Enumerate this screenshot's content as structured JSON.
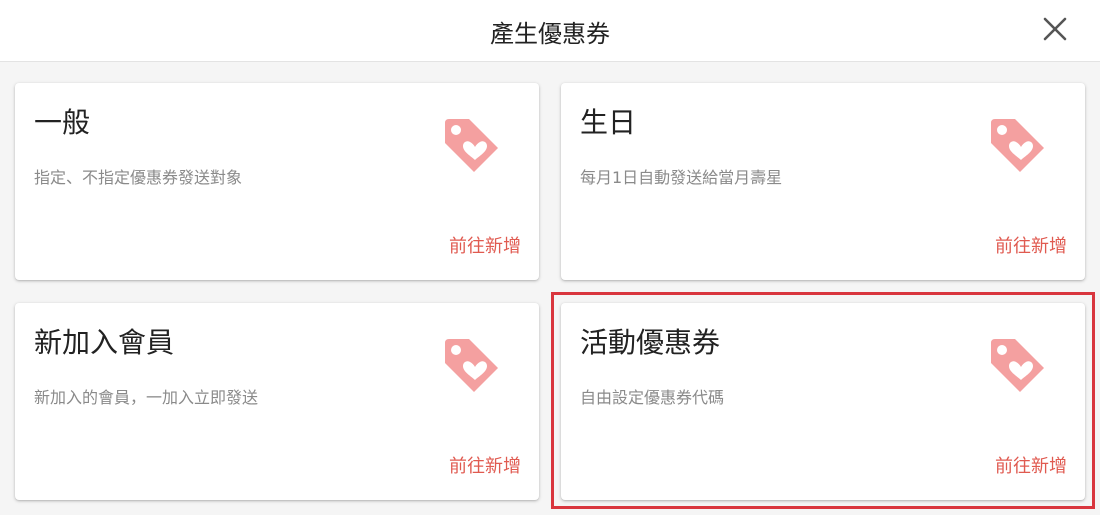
{
  "header": {
    "title": "產生優惠券",
    "close_icon": "close-icon"
  },
  "colors": {
    "accent": "#e05a50",
    "tag_icon": "#f4a0a0",
    "highlight_border": "#d9363e"
  },
  "cards": [
    {
      "title": "一般",
      "description": "指定、不指定優惠券發送對象",
      "action": "前往新增",
      "icon": "tag-heart-icon"
    },
    {
      "title": "生日",
      "description": "每月1日自動發送給當月壽星",
      "action": "前往新增",
      "icon": "tag-heart-icon"
    },
    {
      "title": "新加入會員",
      "description": "新加入的會員，一加入立即發送",
      "action": "前往新增",
      "icon": "tag-heart-icon"
    },
    {
      "title": "活動優惠券",
      "description": "自由設定優惠券代碼",
      "action": "前往新增",
      "icon": "tag-heart-icon",
      "highlighted": true
    }
  ]
}
